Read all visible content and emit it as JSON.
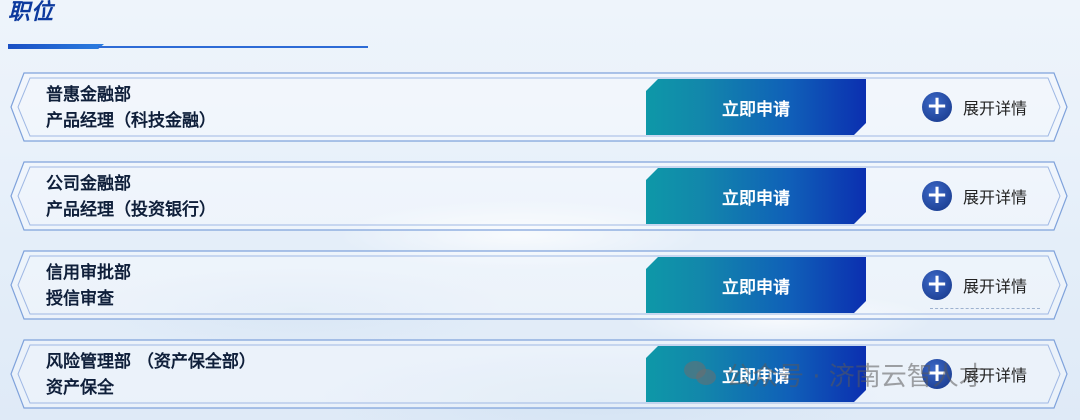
{
  "section": {
    "title": "职位"
  },
  "jobs": [
    {
      "dept": "普惠金融部",
      "position": "产品经理（科技金融）",
      "apply_label": "立即申请",
      "details_label": "展开详情"
    },
    {
      "dept": "公司金融部",
      "position": "产品经理（投资银行）",
      "apply_label": "立即申请",
      "details_label": "展开详情"
    },
    {
      "dept": "信用审批部",
      "position": "授信审查",
      "apply_label": "立即申请",
      "details_label": "展开详情"
    },
    {
      "dept": "风险管理部 （资产保全部）",
      "position": "资产保全",
      "apply_label": "立即申请",
      "details_label": "展开详情"
    }
  ],
  "watermark": {
    "text": "公众号 · 济南云智人才",
    "icon": "wechat-icon"
  },
  "colors": {
    "accent": "#0d3a9e",
    "button_start": "#0e98a8",
    "button_end": "#0b2fb0",
    "frame": "#6f97d8"
  }
}
